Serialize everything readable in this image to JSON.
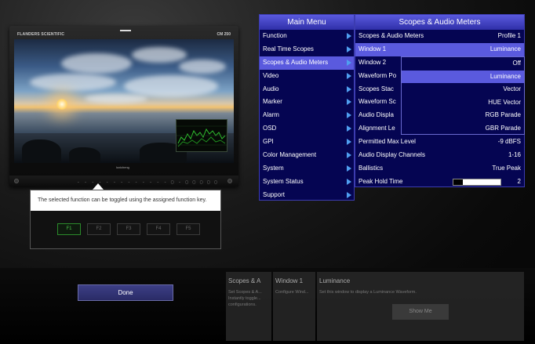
{
  "monitor": {
    "brand": "FLANDERS SCIENTIFIC",
    "model": "CM 250",
    "bezel_logo": "luxicheng",
    "bezel_buttons": "- - - - - -   - - - - - -   - ▢ -  ▢ ▢ ▢ ▢ ▢"
  },
  "tooltip": {
    "text": "The selected function can be toggled using the assigned function key.",
    "fkeys": [
      "F1",
      "F2",
      "F3",
      "F4",
      "F5"
    ],
    "active_fkey": "F1"
  },
  "done_button": "Done",
  "main_menu": {
    "title": "Main Menu",
    "items": [
      "Function",
      "Real Time Scopes",
      "Scopes & Audio Meters",
      "Video",
      "Audio",
      "Marker",
      "Alarm",
      "OSD",
      "GPI",
      "Color Management",
      "System",
      "System Status",
      "Support"
    ],
    "selected": "Scopes & Audio Meters"
  },
  "sub_menu": {
    "title": "Scopes & Audio Meters",
    "items": [
      {
        "label": "Scopes & Audio Meters",
        "value": "Profile 1"
      },
      {
        "label": "Window 1",
        "value": "Luminance"
      },
      {
        "label": "Window 2",
        "value": ""
      },
      {
        "label": "Waveform Po",
        "value": ""
      },
      {
        "label": "Scopes Stac",
        "value": ""
      },
      {
        "label": "Waveform Sc",
        "value": ""
      },
      {
        "label": "Audio Displa",
        "value": ""
      },
      {
        "label": "Alignment Le",
        "value": ""
      },
      {
        "label": "Permitted Max Level",
        "value": "-9 dBFS"
      },
      {
        "label": "Audio Display Channels",
        "value": "1-16"
      },
      {
        "label": "Ballistics",
        "value": "True Peak"
      },
      {
        "label": "Peak Hold Time",
        "value": "2"
      }
    ],
    "selected": "Window 1",
    "peak_hold_level": 0.2
  },
  "dropdown": {
    "options": [
      "Off",
      "Luminance",
      "Vector",
      "HUE Vector",
      "RGB Parade",
      "GBR Parade"
    ],
    "selected": "Luminance"
  },
  "help": [
    {
      "title": "Scopes & A",
      "desc": "Set Scopes & A... Instantly toggle... configurations."
    },
    {
      "title": "Window 1",
      "desc": "Configure Wind..."
    },
    {
      "title": "Luminance",
      "desc": "Set this window to display a Luminance Waveform.",
      "button": "Show Me"
    }
  ],
  "colors": {
    "menu_bg": "#050552",
    "menu_highlight": "#5a5ade",
    "arrow": "#4f9ef0",
    "fkey_active": "#46c046"
  }
}
